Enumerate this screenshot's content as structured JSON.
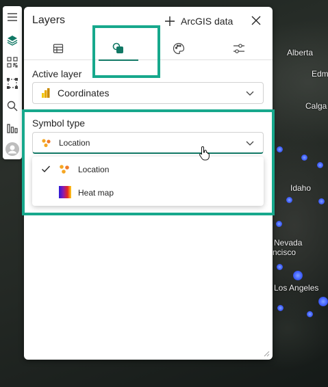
{
  "map": {
    "labels": [
      "Alberta",
      "Edm",
      "Calga",
      "Idaho",
      "Nevada",
      "ncisco",
      "Los Angeles"
    ]
  },
  "toolbar": {
    "icons": [
      "hamburger-icon",
      "layers-icon",
      "qr-code-icon",
      "select-area-icon",
      "search-icon",
      "chart-icon",
      "avatar-icon"
    ]
  },
  "panel": {
    "title": "Layers",
    "add_data_label": "ArcGIS data",
    "tabs": [
      "table-icon",
      "symbology-icon",
      "palette-icon",
      "settings-sliders-icon"
    ],
    "active_tab": 1
  },
  "active_layer": {
    "label": "Active layer",
    "value": "Coordinates",
    "icon": "power-bi-icon"
  },
  "symbol_type": {
    "label": "Symbol type",
    "value": "Location",
    "options": [
      {
        "label": "Location",
        "icon": "location-dots-icon",
        "selected": true
      },
      {
        "label": "Heat map",
        "icon": "heat-map-icon",
        "selected": false
      }
    ]
  },
  "colors": {
    "accent": "#117865",
    "highlight": "#17a88c",
    "point": "#3d5cff"
  }
}
